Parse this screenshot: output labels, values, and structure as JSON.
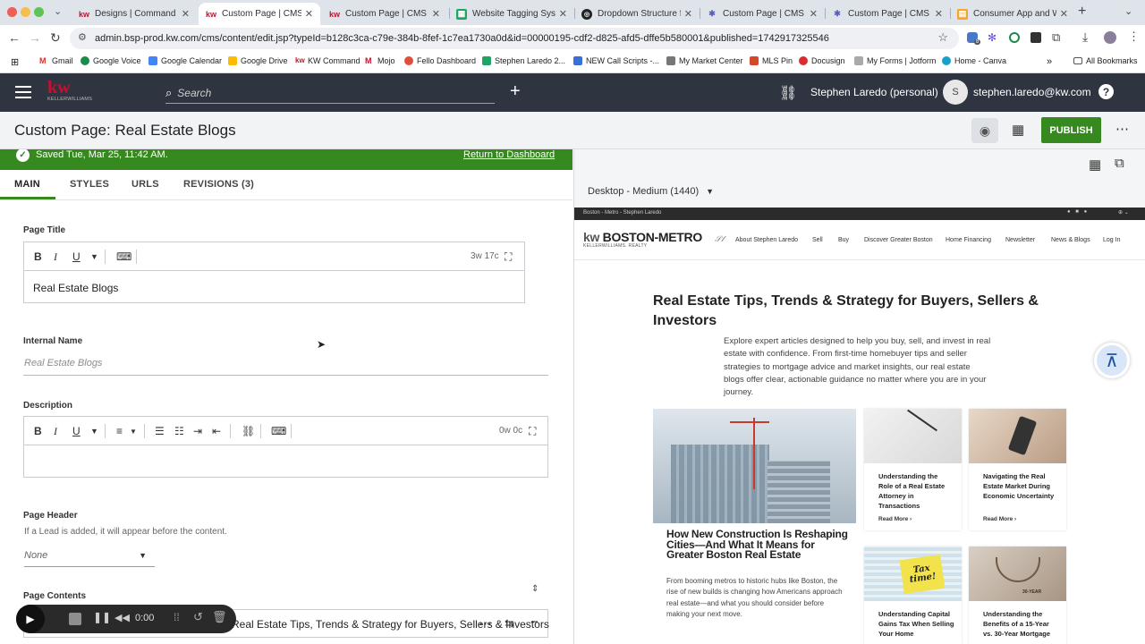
{
  "browser": {
    "tabs": [
      {
        "title": "Designs | Command",
        "fav": "kw",
        "active": false
      },
      {
        "title": "Custom Page | CMS |",
        "fav": "kw",
        "active": true
      },
      {
        "title": "Custom Page | CMS | Br",
        "fav": "kw",
        "active": false
      },
      {
        "title": "Website Tagging System",
        "fav": "sheet",
        "active": false
      },
      {
        "title": "Dropdown Structure for",
        "fav": "circle",
        "active": false
      },
      {
        "title": "Custom Page | CMS | Br",
        "fav": "gear",
        "active": false
      },
      {
        "title": "Custom Page | CMS | Br",
        "fav": "gear",
        "active": false
      },
      {
        "title": "Consumer App and Web",
        "fav": "doc",
        "active": false
      }
    ],
    "url": "admin.bsp-prod.kw.com/cms/content/edit.jsp?typeId=b128c3ca-c79e-384b-8fef-1c7ea1730a0d&id=00000195-cdf2-d825-afd5-dffe5b580001&published=1742917325546",
    "bookmarks": [
      "Gmail",
      "Google Voice",
      "Google Calendar",
      "Google Drive",
      "KW Command",
      "Mojo",
      "Fello Dashboard",
      "Stephen Laredo 2...",
      "NEW Call Scripts -...",
      "My Market Center",
      "MLS Pin",
      "Docusign",
      "My Forms | Jotform",
      "Home - Canva"
    ],
    "all_bookmarks": "All Bookmarks",
    "extension_badge": "8"
  },
  "kw_header": {
    "logo_top": "kw",
    "logo_bottom": "KELLERWILLIAMS",
    "search_placeholder": "Search",
    "account": "Stephen Laredo (personal)",
    "avatar_initial": "S",
    "email": "stephen.laredo@kw.com"
  },
  "page": {
    "title": "Custom Page: Real Estate Blogs",
    "publish": "PUBLISH"
  },
  "editor": {
    "saved": "Saved Tue, Mar 25, 11:42 AM.",
    "return_link": "Return to Dashboard",
    "tabs": [
      "MAIN",
      "STYLES",
      "URLS",
      "REVISIONS (3)"
    ],
    "page_title_label": "Page Title",
    "page_title_count": "3w 17c",
    "page_title_value": "Real Estate Blogs",
    "internal_name_label": "Internal Name",
    "internal_name_placeholder": "Real Estate Blogs",
    "description_label": "Description",
    "description_count": "0w 0c",
    "page_header_label": "Page Header",
    "page_header_help": "If a Lead is added, it will appear before the content.",
    "page_header_value": "None",
    "page_contents_label": "Page Contents",
    "content_item": "Real Estate Tips, Trends & Strategy for Buyers, Sellers & Investors"
  },
  "preview": {
    "device": "Desktop - Medium (1440)",
    "topbar": "Boston - Metro - Stephen Laredo",
    "logo_main": "BOSTON-METRO",
    "logo_sub": "KELLERWILLIAMS. REALTY",
    "nav": [
      "About Stephen Laredo",
      "Sell",
      "Buy",
      "Discover Greater Boston",
      "Home Financing",
      "Newsletter",
      "News & Blogs",
      "Log In"
    ],
    "heading": "Real Estate Tips, Trends & Strategy for Buyers, Sellers & Investors",
    "intro": "Explore expert articles designed to help you buy, sell, and invest in real estate with confidence. From first-time homebuyer tips and seller strategies to mortgage advice and market insights, our real estate blogs offer clear, actionable guidance no matter where you are in your journey.",
    "featured_title": "How New Construction Is Reshaping Cities—And What It Means for Greater Boston Real Estate",
    "featured_text": "From booming metros to historic hubs like Boston, the rise of new builds is changing how Americans approach real estate—and what you should consider before making your next move.",
    "cards": [
      {
        "title": "Understanding the Role of a Real Estate Attorney in Transactions",
        "more": "Read More"
      },
      {
        "title": "Navigating the Real Estate Market During Economic Uncertainty",
        "more": "Read More"
      },
      {
        "title": "Understanding Capital Gains Tax When Selling Your Home",
        "tag": "Tax time!"
      },
      {
        "title": "Understanding the Benefits of a 15-Year vs. 30-Year Mortgage",
        "tag": "30-YEAR"
      }
    ]
  },
  "recorder": {
    "time": "0:00"
  }
}
